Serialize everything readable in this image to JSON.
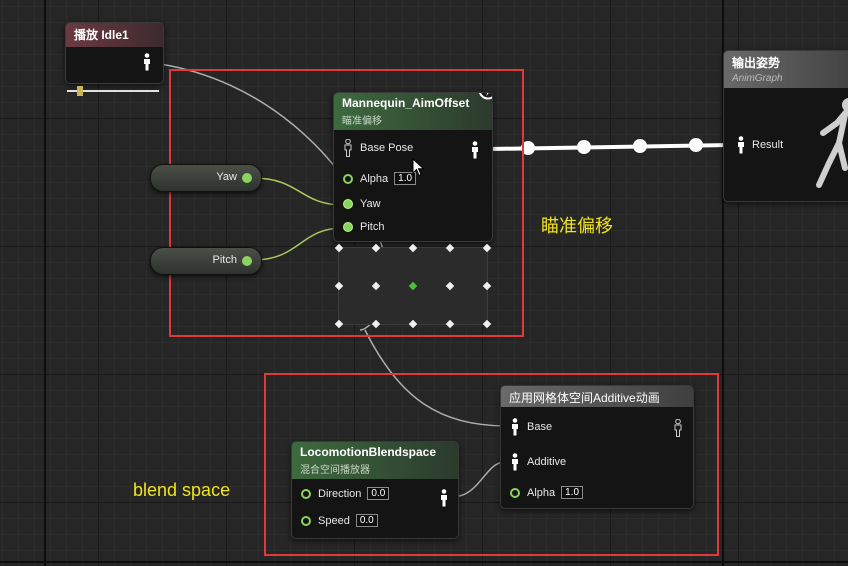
{
  "nodes": {
    "play_idle": {
      "title": "播放 Idle1",
      "slider_position": 0.12
    },
    "aim_offset": {
      "title": "Mannequin_AimOffset",
      "subtitle": "瞄准偏移",
      "base_pose_label": "Base Pose",
      "alpha_label": "Alpha",
      "alpha_value": "1.0",
      "yaw_label": "Yaw",
      "pitch_label": "Pitch"
    },
    "output_pose": {
      "title": "输出姿势",
      "subtitle": "AnimGraph",
      "result_label": "Result"
    },
    "yaw_var": {
      "label": "Yaw"
    },
    "pitch_var": {
      "label": "Pitch"
    },
    "apply_additive": {
      "title": "应用网格体空间Additive动画",
      "base_label": "Base",
      "additive_label": "Additive",
      "alpha_label": "Alpha",
      "alpha_value": "1.0"
    },
    "locomotion": {
      "title": "LocomotionBlendspace",
      "subtitle": "混合空间播放器",
      "direction_label": "Direction",
      "direction_value": "0.0",
      "speed_label": "Speed",
      "speed_value": "0.0"
    }
  },
  "annotations": {
    "aim_offset_label": "瞄准偏移",
    "blend_space_label": "blend space"
  },
  "colors": {
    "annotation_box": "#e0393b",
    "annotation_text": "#f2e41a",
    "float_pin": "#8cd25f",
    "pose_wire": "#ffffff",
    "float_wire": "#a8c85a"
  },
  "icons": {
    "pose": "mannequin-figure-icon",
    "property_binding": "lightning-bolt-icon",
    "cursor": "mouse-pointer-icon"
  }
}
